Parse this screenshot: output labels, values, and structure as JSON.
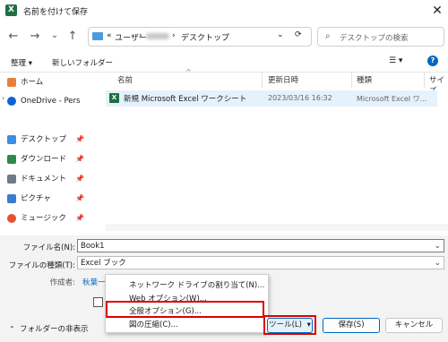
{
  "window": {
    "title": "名前を付けて保存",
    "app_icon": "X",
    "close": "✕"
  },
  "nav": {
    "back": "←",
    "forward": "→",
    "dropdown": "⌄",
    "up": "↑",
    "address": {
      "prefix": "«",
      "segment1": "ユーザー",
      "sep": "›",
      "segment3": "デスクトップ",
      "chevron": "⌄",
      "refresh": "⟳"
    },
    "search_placeholder": "デスクトップの検索"
  },
  "toolbar": {
    "organize": "整理 ▾",
    "new_folder": "新しいフォルダー",
    "view": "☰ ▾",
    "help": "?"
  },
  "sidebar": {
    "items": [
      {
        "label": "ホーム",
        "color": "#e8803a"
      },
      {
        "label": "OneDrive - Pers",
        "color": "#0a64d6"
      },
      {
        "label": "デスクトップ",
        "color": "#3d8de0"
      },
      {
        "label": "ダウンロード",
        "color": "#2a8a4a"
      },
      {
        "label": "ドキュメント",
        "color": "#6c7a89"
      },
      {
        "label": "ピクチャ",
        "color": "#3a7bd5"
      },
      {
        "label": "ミュージック",
        "color": "#e2532f"
      }
    ],
    "pin": "📌"
  },
  "files": {
    "columns": [
      "名前",
      "更新日時",
      "種類",
      "サイズ"
    ],
    "rows": [
      {
        "name": "新規 Microsoft Excel ワークシート",
        "date": "2023/03/16 16:32",
        "type": "Microsoft Excel ワ..."
      }
    ]
  },
  "form": {
    "filename_label": "ファイル名(N):",
    "filename_value": "Book1",
    "filetype_label": "ファイルの種類(T):",
    "filetype_value": "Excel ブック",
    "author_label": "作成者:",
    "author_value": "秋葉一"
  },
  "tools_menu": {
    "items": [
      "ネットワーク ドライブの割り当て(N)...",
      "Web オプション(W)...",
      "全般オプション(G)...",
      "図の圧縮(C)..."
    ]
  },
  "buttons": {
    "tools": "ツール(L)",
    "tools_arrow": "▾",
    "save": "保存(S)",
    "cancel": "キャンセル",
    "hide_folders": "フォルダーの非表示"
  },
  "colors": {
    "highlight": "#e00000",
    "selection": "#e5f1fb",
    "primary_border": "#0067c0"
  }
}
